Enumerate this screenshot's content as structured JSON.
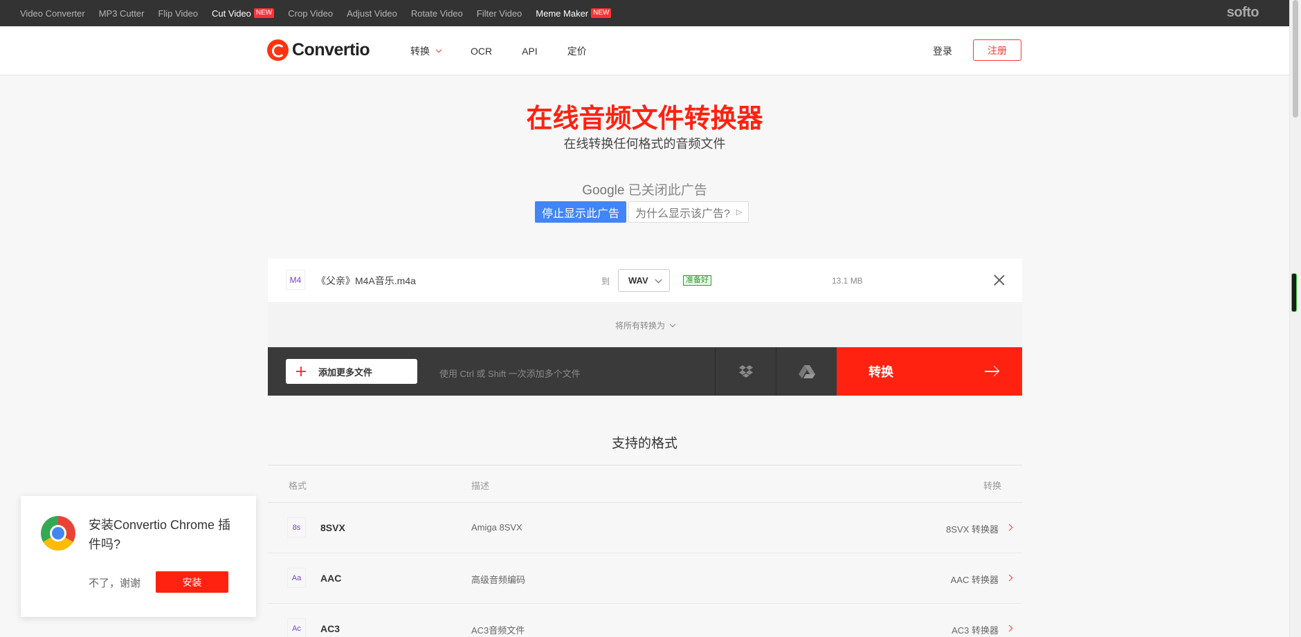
{
  "topbar": {
    "links": [
      {
        "label": "Video Converter",
        "new": false,
        "active": false
      },
      {
        "label": "MP3 Cutter",
        "new": false,
        "active": false
      },
      {
        "label": "Flip Video",
        "new": false,
        "active": false
      },
      {
        "label": "Cut Video",
        "new": true,
        "active": true
      },
      {
        "label": "Crop Video",
        "new": false,
        "active": false
      },
      {
        "label": "Adjust Video",
        "new": false,
        "active": false
      },
      {
        "label": "Rotate Video",
        "new": false,
        "active": false
      },
      {
        "label": "Filter Video",
        "new": false,
        "active": false
      },
      {
        "label": "Meme Maker",
        "new": true,
        "active": true
      }
    ],
    "new_badge": "NEW",
    "brand": "softo"
  },
  "header": {
    "logo_text": "Convertio",
    "nav": [
      "转换",
      "OCR",
      "API",
      "定价"
    ],
    "login": "登录",
    "signup": "注册"
  },
  "hero": {
    "title": "在线音频文件转换器",
    "subtitle": "在线转换任何格式的音频文件"
  },
  "ad": {
    "google": "Google",
    "closed_text": "已关闭此广告",
    "stop_button": "停止显示此广告",
    "why_button": "为什么显示该广告?"
  },
  "file": {
    "icon": "M4",
    "name": "《父亲》M4A音乐.m4a",
    "to_label": "到",
    "format": "WAV",
    "status": "准备好",
    "size": "13.1 MB"
  },
  "convert_all": "将所有转换为",
  "action_bar": {
    "add_more": "添加更多文件",
    "hint": "使用 Ctrl 或 Shift 一次添加多个文件",
    "convert": "转换"
  },
  "formats": {
    "title": "支持的格式",
    "headers": {
      "format": "格式",
      "description": "描述",
      "convert": "转换"
    },
    "rows": [
      {
        "icon": "8s",
        "name": "8SVX",
        "description": "Amiga 8SVX",
        "convert": "8SVX 转换器"
      },
      {
        "icon": "Aa",
        "name": "AAC",
        "description": "高级音频编码",
        "convert": "AAC 转换器"
      },
      {
        "icon": "Ac",
        "name": "AC3",
        "description": "AC3音频文件",
        "convert": "AC3 转换器"
      }
    ]
  },
  "extension_popup": {
    "text": "安装Convertio Chrome 插件吗?",
    "decline": "不了，谢谢",
    "install": "安装"
  },
  "colors": {
    "accent": "#ff2211",
    "topbar": "#333333",
    "google_blue": "#4285f4"
  }
}
